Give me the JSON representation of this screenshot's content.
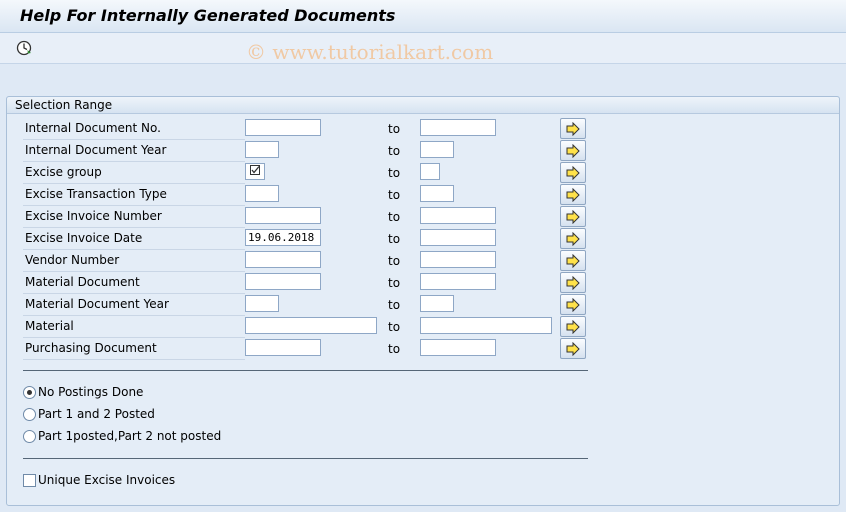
{
  "window": {
    "title": "Help For Internally Generated Documents"
  },
  "toolbar": {
    "execute_icon": "execute-clock-icon"
  },
  "watermark": "© www.tutorialkart.com",
  "panel": {
    "title": "Selection Range",
    "to_label": "to",
    "multiple_selection_icon": "arrow-right-icon",
    "rows": [
      {
        "label": "Internal Document No.",
        "from": "",
        "to": ""
      },
      {
        "label": "Internal Document Year",
        "from": "",
        "to": ""
      },
      {
        "label": "Excise group",
        "from": "",
        "to": ""
      },
      {
        "label": "Excise Transaction Type",
        "from": "",
        "to": ""
      },
      {
        "label": "Excise Invoice Number",
        "from": "",
        "to": ""
      },
      {
        "label": "Excise Invoice Date",
        "from": "19.06.2018",
        "to": ""
      },
      {
        "label": "Vendor Number",
        "from": "",
        "to": ""
      },
      {
        "label": "Material Document",
        "from": "",
        "to": ""
      },
      {
        "label": "Material Document Year",
        "from": "",
        "to": ""
      },
      {
        "label": "Material",
        "from": "",
        "to": ""
      },
      {
        "label": "Purchasing Document",
        "from": "",
        "to": ""
      }
    ],
    "radios": [
      {
        "label": "No Postings Done",
        "selected": true
      },
      {
        "label": "Part 1 and 2 Posted",
        "selected": false
      },
      {
        "label": "Part 1posted,Part 2 not posted",
        "selected": false
      }
    ],
    "checkbox": {
      "label": "Unique Excise Invoices",
      "checked": false
    }
  }
}
